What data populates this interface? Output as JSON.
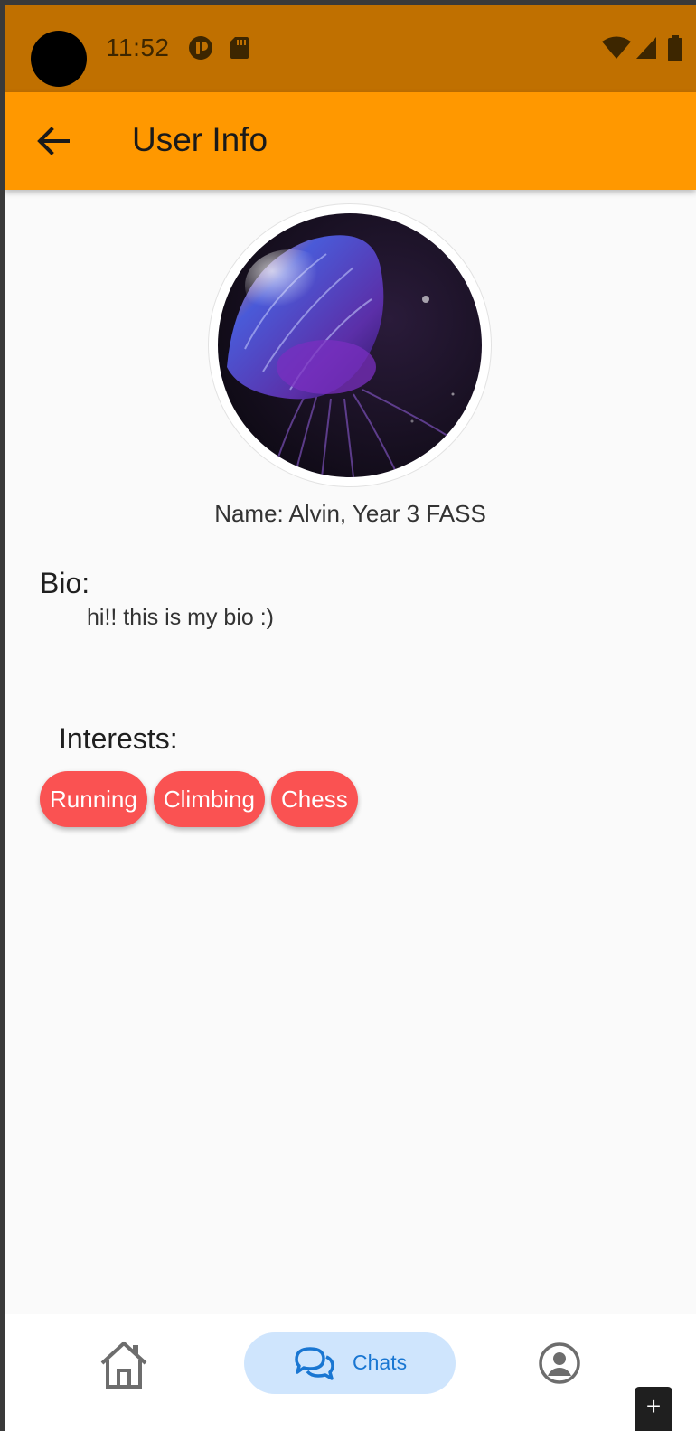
{
  "status_bar": {
    "time": "11:52",
    "left_icons": [
      "cast-app-icon",
      "sd-card-icon"
    ],
    "right_icons": [
      "wifi-icon",
      "cellular-signal-icon",
      "battery-icon"
    ],
    "color": "#c07000"
  },
  "app_bar": {
    "title": "User Info",
    "back_icon": "arrow-back-icon",
    "color": "#ff9800"
  },
  "profile": {
    "avatar_alt": "jellyfish-profile-image",
    "name_line": "Name: Alvin, Year 3 FASS",
    "bio_heading": "Bio:",
    "bio_text": "hi!! this is my bio :)",
    "interests_heading": "Interests:",
    "interests": [
      "Running",
      "Climbing",
      "Chess"
    ],
    "chip_color": "#fa5252"
  },
  "bottom_nav": {
    "items": [
      {
        "name": "home",
        "icon": "home-icon",
        "label": ""
      },
      {
        "name": "chats",
        "icon": "chat-bubbles-icon",
        "label": "Chats",
        "selected": true
      },
      {
        "name": "profile",
        "icon": "account-circle-icon",
        "label": ""
      }
    ],
    "active_color": "#1976d2",
    "active_bg": "#cfe5fd"
  },
  "fab_mini": {
    "icon": "plus-icon",
    "label": "+"
  }
}
